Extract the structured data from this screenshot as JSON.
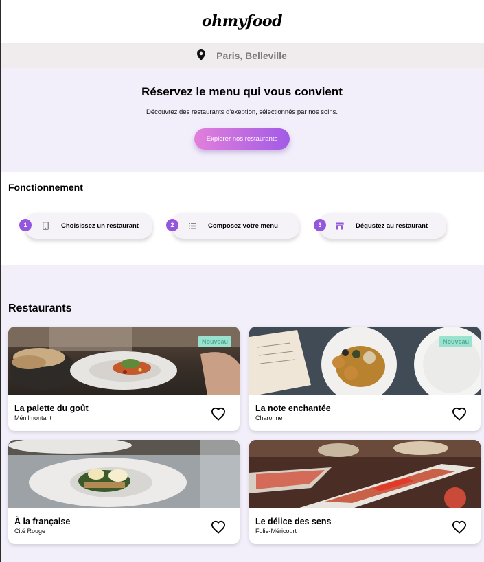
{
  "header": {
    "logo": "ohmyfood"
  },
  "location": {
    "icon": "map-pin-icon",
    "text": "Paris, Belleville"
  },
  "hero": {
    "title": "Réservez le menu qui vous convient",
    "subtitle": "Découvrez des restaurants d'exeption, sélectionnés par nos soins.",
    "cta": "Explorer nos restaurants"
  },
  "how": {
    "title": "Fonctionnement",
    "steps": [
      {
        "number": "1",
        "icon": "mobile-phone-icon",
        "label": "Choisissez un restaurant"
      },
      {
        "number": "2",
        "icon": "list-icon",
        "label": "Composez votre menu"
      },
      {
        "number": "3",
        "icon": "store-icon",
        "label": "Dégustez au restaurant"
      }
    ]
  },
  "restaurants": {
    "title": "Restaurants",
    "items": [
      {
        "name": "La palette du goût",
        "district": "Ménilmontant",
        "badge": "Nouveau",
        "icon": "heart-icon"
      },
      {
        "name": "La note enchantée",
        "district": "Charonne",
        "badge": "Nouveau",
        "icon": "heart-icon"
      },
      {
        "name": "À la française",
        "district": "Cité Rouge",
        "badge": "",
        "icon": "heart-icon"
      },
      {
        "name": "Le délice des sens",
        "district": "Folie-Méricourt",
        "badge": "",
        "icon": "heart-icon"
      }
    ]
  },
  "colors": {
    "accent": "#9356dc",
    "gradient_start": "#e27fdb",
    "gradient_end": "#a15be6",
    "badge_bg": "#99e2d0",
    "section_bg": "#f2effa"
  }
}
